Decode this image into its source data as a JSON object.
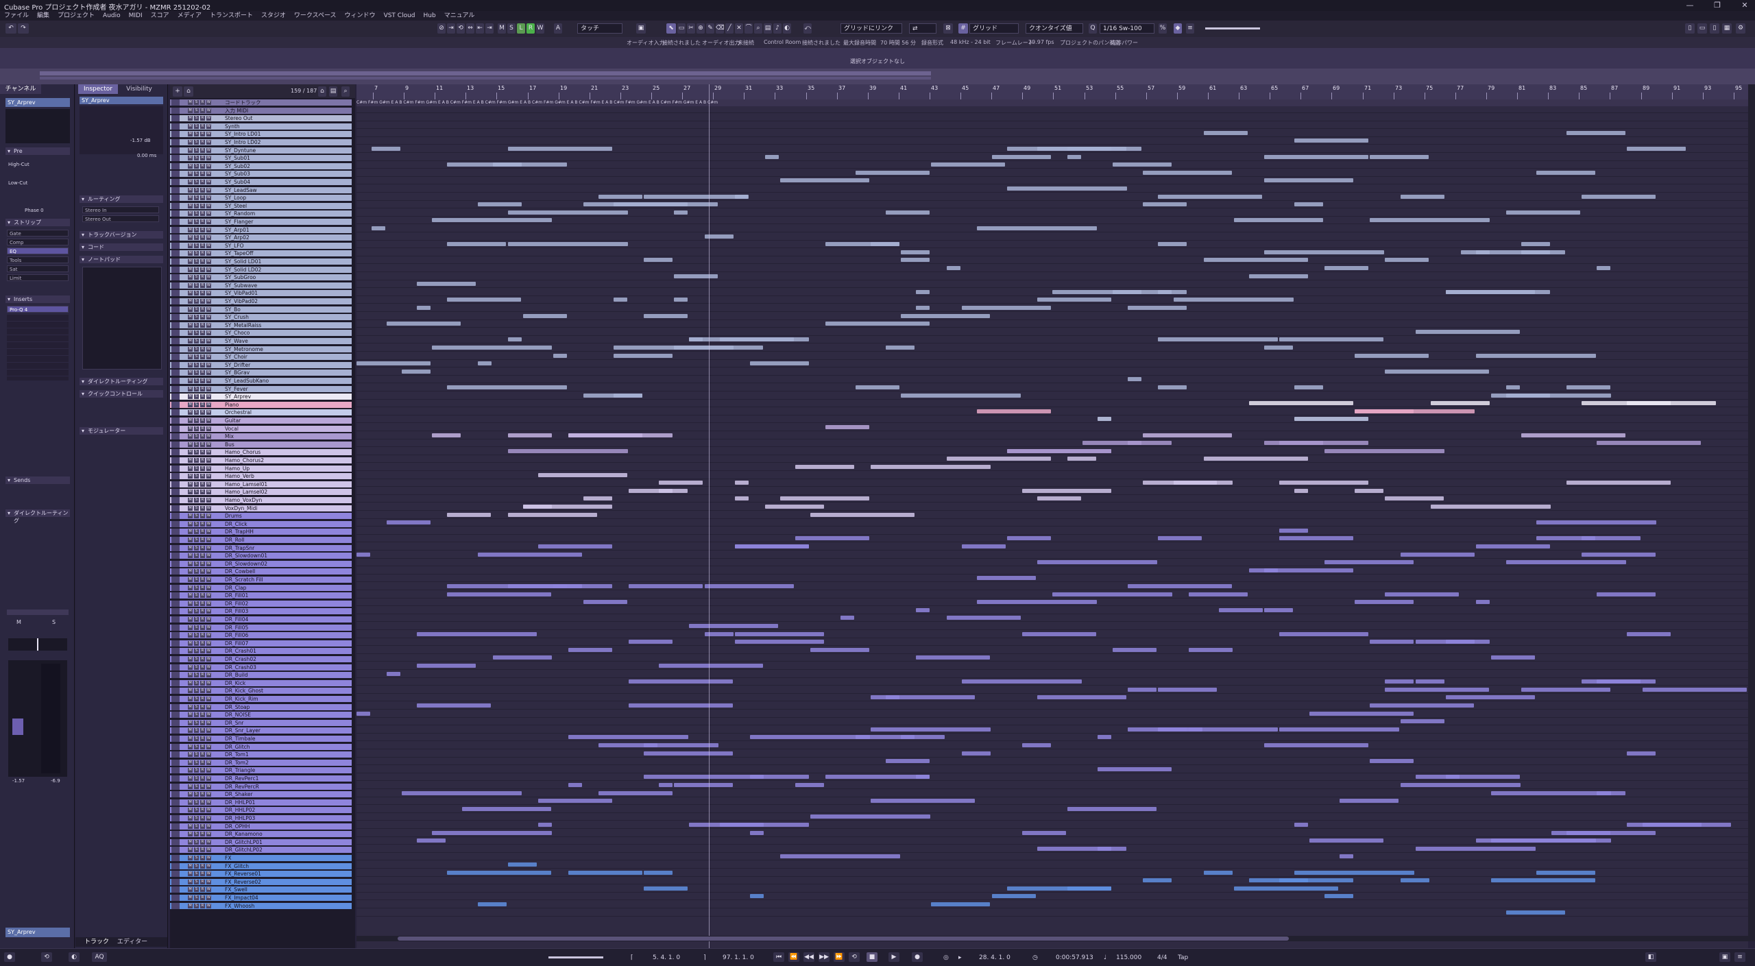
{
  "window": {
    "title": "Cubase Pro プロジェクト作成者 夜水アガリ - MZMR 251202-02",
    "controls": [
      "—",
      "❐",
      "✕"
    ]
  },
  "menu": [
    "ファイル",
    "編集",
    "プロジェクト",
    "Audio",
    "MIDI",
    "スコア",
    "メディア",
    "トランスポート",
    "スタジオ",
    "ワークスペース",
    "ウィンドウ",
    "VST Cloud",
    "Hub",
    "マニュアル"
  ],
  "toolbar": {
    "mode_buttons": [
      "M",
      "S",
      "L",
      "R",
      "W",
      "A"
    ],
    "touch_mode": "タッチ",
    "snap_mode": "グリッドにリンク",
    "grid_label": "グリッド",
    "quantize_label": "クオンタイズ値",
    "quantize_value": "1/16 Sw-100",
    "tool_icons": [
      "object-select-icon",
      "range-icon",
      "split-icon",
      "glue-icon",
      "erase-icon",
      "zoom-icon",
      "mute-icon",
      "time-warp-icon",
      "draw-icon",
      "line-icon",
      "play-icon",
      "color-icon"
    ]
  },
  "status": {
    "audio_input": "オーディオ入力",
    "input_state": "接続されました",
    "audio_output": "オーディオ出力",
    "output_state": "未接続",
    "control_room": "Control Room",
    "cr_state": "接続されました",
    "max_record": "最大録音時間",
    "max_record_value": "70 時間 56 分",
    "record_format": "録音形式",
    "record_format_value": "48 kHz - 24 bit",
    "frame_rate": "フレームレート",
    "frame_rate_value": "29.97 fps",
    "pan_law": "プロジェクトのパン補正",
    "pan_law_value": "均等パワー"
  },
  "info_line": "選択オブジェクトなし",
  "left_zone": {
    "tab": "チャンネル",
    "track": "SY_Arprev",
    "sections": [
      "Pre",
      "ストリップ",
      "Inserts",
      "Sends",
      "ダイレクトルーティング"
    ],
    "pre": {
      "high_cut": "High-Cut",
      "low_cut": "Low-Cut",
      "phase": "Phase 0"
    },
    "strip": [
      "Gate",
      "Comp",
      "EQ",
      "Tools",
      "Sat",
      "Limit"
    ],
    "insert": "Pro-Q 4",
    "fader": {
      "value": "-1.57",
      "pan": "-6.9"
    }
  },
  "inspector": {
    "tabs": [
      "Inspector",
      "Visibility"
    ],
    "track": "SY_Arprev",
    "volume": "-1.57 dB",
    "pan": "0.00 ms",
    "sections": [
      "ルーティング",
      "トラックバージョン",
      "コード",
      "ノートパッド",
      "ダイレクトルーティング",
      "クイックコントロール",
      "モジュレーター"
    ],
    "routing_in": "Stereo In",
    "routing_out": "Stereo Out",
    "bottom_tabs": [
      "トラック",
      "エディター"
    ]
  },
  "tracklist": {
    "count": "159 / 187",
    "tracks": [
      {
        "name": "コードトラック",
        "color": "#7d75a8"
      },
      {
        "name": "入力 MIDI",
        "color": "#7d75a8"
      },
      {
        "name": "Stereo Out",
        "color": "#b3b9d4"
      },
      {
        "name": "Synth",
        "color": "#a7b1d3"
      },
      {
        "name": "SY_Intro LD01",
        "color": "#a7b1d3"
      },
      {
        "name": "SY_Intro LD02",
        "color": "#a7b1d3"
      },
      {
        "name": "SY_Dyntune",
        "color": "#a7b1d3"
      },
      {
        "name": "SY_Sub01",
        "color": "#a7b1d3"
      },
      {
        "name": "SY_Sub02",
        "color": "#a7b1d3"
      },
      {
        "name": "SY_Sub03",
        "color": "#a7b1d3"
      },
      {
        "name": "SY_Sub04",
        "color": "#a7b1d3"
      },
      {
        "name": "SY_LeadSaw",
        "color": "#a7b1d3"
      },
      {
        "name": "SY_Loop",
        "color": "#a7b1d3"
      },
      {
        "name": "SY_Steel",
        "color": "#a7b1d3"
      },
      {
        "name": "SY_Random",
        "color": "#a7b1d3"
      },
      {
        "name": "SY_Flanger",
        "color": "#a7b1d3"
      },
      {
        "name": "SY_Arp01",
        "color": "#a7b1d3"
      },
      {
        "name": "SY_Arp02",
        "color": "#a7b1d3"
      },
      {
        "name": "SY_LFO",
        "color": "#a7b1d3"
      },
      {
        "name": "SY_TapeOff",
        "color": "#a7b1d3"
      },
      {
        "name": "SY_Solid LD01",
        "color": "#a7b1d3"
      },
      {
        "name": "SY_Solid LD02",
        "color": "#a7b1d3"
      },
      {
        "name": "SY_SubGroo",
        "color": "#a7b1d3"
      },
      {
        "name": "SY_Subwave",
        "color": "#a7b1d3"
      },
      {
        "name": "SY_VibPad01",
        "color": "#a7b1d3"
      },
      {
        "name": "SY_VibPad02",
        "color": "#a7b1d3"
      },
      {
        "name": "SY_Bo",
        "color": "#a7b1d3"
      },
      {
        "name": "SY_Crush",
        "color": "#a7b1d3"
      },
      {
        "name": "SY_MetalRaiss",
        "color": "#a7b1d3"
      },
      {
        "name": "SY_Choco",
        "color": "#a7b1d3"
      },
      {
        "name": "SY_Wave",
        "color": "#a7b1d3"
      },
      {
        "name": "SY_Metronome",
        "color": "#a7b1d3"
      },
      {
        "name": "SY_Choir",
        "color": "#a7b1d3"
      },
      {
        "name": "SY_Drifter",
        "color": "#a7b1d3"
      },
      {
        "name": "SY_BGrav",
        "color": "#a7b1d3"
      },
      {
        "name": "SY_LeadSubKano",
        "color": "#a7b1d3"
      },
      {
        "name": "SY_Fever",
        "color": "#a7b1d3"
      },
      {
        "name": "SY_Arprev",
        "color": "#ece9f4"
      },
      {
        "name": "Piano",
        "color": "#e8a8c6"
      },
      {
        "name": "Orchestral",
        "color": "#c3ccea"
      },
      {
        "name": "Guitar",
        "color": "#b8a6d8"
      },
      {
        "name": "Vocal",
        "color": "#c3b3e0"
      },
      {
        "name": "Mix",
        "color": "#a998cf"
      },
      {
        "name": "Bus",
        "color": "#a998cf"
      },
      {
        "name": "Hamo_Chorus",
        "color": "#cfc4e8"
      },
      {
        "name": "Hamo_Chorus2",
        "color": "#cfc4e8"
      },
      {
        "name": "Hamo_Up",
        "color": "#cfc4e8"
      },
      {
        "name": "Hamo_Verb",
        "color": "#cfc4e8"
      },
      {
        "name": "Hamo_Lamsel01",
        "color": "#cfc4e8"
      },
      {
        "name": "Hamo_Lamsel02",
        "color": "#cfc4e8"
      },
      {
        "name": "Hamo_VoxDyn",
        "color": "#cfc4e8"
      },
      {
        "name": "VoxDyn_Midi",
        "color": "#cfc4e8"
      },
      {
        "name": "Drums",
        "color": "#8f85dc"
      },
      {
        "name": "DR_Click",
        "color": "#8f85dc"
      },
      {
        "name": "DR_TrapHH",
        "color": "#8f85dc"
      },
      {
        "name": "DR_Roll",
        "color": "#8f85dc"
      },
      {
        "name": "DR_TrapSnr",
        "color": "#8f85dc"
      },
      {
        "name": "DR_Slowdown01",
        "color": "#8f85dc"
      },
      {
        "name": "DR_Slowdown02",
        "color": "#8f85dc"
      },
      {
        "name": "DR_Cowbell",
        "color": "#8f85dc"
      },
      {
        "name": "DR_Scratch Fill",
        "color": "#8f85dc"
      },
      {
        "name": "DR_Clap",
        "color": "#8f85dc"
      },
      {
        "name": "DR_Fill01",
        "color": "#8f85dc"
      },
      {
        "name": "DR_Fill02",
        "color": "#8f85dc"
      },
      {
        "name": "DR_Fill03",
        "color": "#8f85dc"
      },
      {
        "name": "DR_Fill04",
        "color": "#8f85dc"
      },
      {
        "name": "DR_Fill05",
        "color": "#8f85dc"
      },
      {
        "name": "DR_Fill06",
        "color": "#8f85dc"
      },
      {
        "name": "DR_Fill07",
        "color": "#8f85dc"
      },
      {
        "name": "DR_Crash01",
        "color": "#8f85dc"
      },
      {
        "name": "DR_Crash02",
        "color": "#8f85dc"
      },
      {
        "name": "DR_Crash03",
        "color": "#8f85dc"
      },
      {
        "name": "DR_Build",
        "color": "#8f85dc"
      },
      {
        "name": "DR_Kick",
        "color": "#8f85dc"
      },
      {
        "name": "DR_Kick_Ghost",
        "color": "#8f85dc"
      },
      {
        "name": "DR_Kick_Rim",
        "color": "#8f85dc"
      },
      {
        "name": "DR_Stoap",
        "color": "#8f85dc"
      },
      {
        "name": "DR_NOISE",
        "color": "#8f85dc"
      },
      {
        "name": "DR_Snr",
        "color": "#8f85dc"
      },
      {
        "name": "DR_Snr_Layer",
        "color": "#8f85dc"
      },
      {
        "name": "DR_Timbale",
        "color": "#8f85dc"
      },
      {
        "name": "DR_Glitch",
        "color": "#8f85dc"
      },
      {
        "name": "DR_Tom1",
        "color": "#8f85dc"
      },
      {
        "name": "DR_Tom2",
        "color": "#8f85dc"
      },
      {
        "name": "DR_Triangle",
        "color": "#8f85dc"
      },
      {
        "name": "DR_RevPerc1",
        "color": "#8f85dc"
      },
      {
        "name": "DR_RevPercR",
        "color": "#8f85dc"
      },
      {
        "name": "DR_Shaker",
        "color": "#8f85dc"
      },
      {
        "name": "DR_HHLP01",
        "color": "#8f85dc"
      },
      {
        "name": "DR_HHLP02",
        "color": "#8f85dc"
      },
      {
        "name": "DR_HHLP03",
        "color": "#8f85dc"
      },
      {
        "name": "DR_OPHH",
        "color": "#8f85dc"
      },
      {
        "name": "DR_Kanamono",
        "color": "#8f85dc"
      },
      {
        "name": "DR_GlitchLP01",
        "color": "#8f85dc"
      },
      {
        "name": "DR_GlitchLP02",
        "color": "#8f85dc"
      },
      {
        "name": "FX",
        "color": "#5f8fe0"
      },
      {
        "name": "FX_Glitch",
        "color": "#5f8fe0"
      },
      {
        "name": "FX_Reverse01",
        "color": "#5f8fe0"
      },
      {
        "name": "FX_Reverse02",
        "color": "#5f8fe0"
      },
      {
        "name": "FX_Swell",
        "color": "#5f8fe0"
      },
      {
        "name": "FX_Impact04",
        "color": "#5f8fe0"
      },
      {
        "name": "FX_Whoosh",
        "color": "#5f8fe0"
      }
    ]
  },
  "ruler": {
    "bars": [
      "7",
      "9",
      "11",
      "13",
      "15",
      "17",
      "19",
      "21",
      "23",
      "25",
      "27",
      "29",
      "31",
      "33",
      "35",
      "37",
      "39",
      "41",
      "43",
      "45",
      "47",
      "49",
      "51",
      "53",
      "55",
      "57",
      "59",
      "61",
      "63",
      "65",
      "67",
      "69",
      "71",
      "73",
      "75",
      "77",
      "79",
      "81",
      "83",
      "85",
      "87",
      "89",
      "91",
      "93",
      "95"
    ]
  },
  "chords": "C#m  F#m  G#m  E  A  B  C#m  F#m  G#m  E  A  B  C#m  F#m  E  A  B  C#m  F#m  G#m  E  A  B  C#m  F#m  G#m  E  A  B  C#m  F#m  E  A  B  C#m  F#m  G#m  E  A  B  C#m  F#m  G#m  E  A  B  C#m",
  "transport": {
    "left_locator": "5. 4. 1. 0",
    "right_locator": "97. 1. 1. 0",
    "position": "28. 4. 1. 0",
    "time": "0:00:57.913",
    "tempo": "115.000",
    "signature": "4/4",
    "tap": "Tap"
  }
}
